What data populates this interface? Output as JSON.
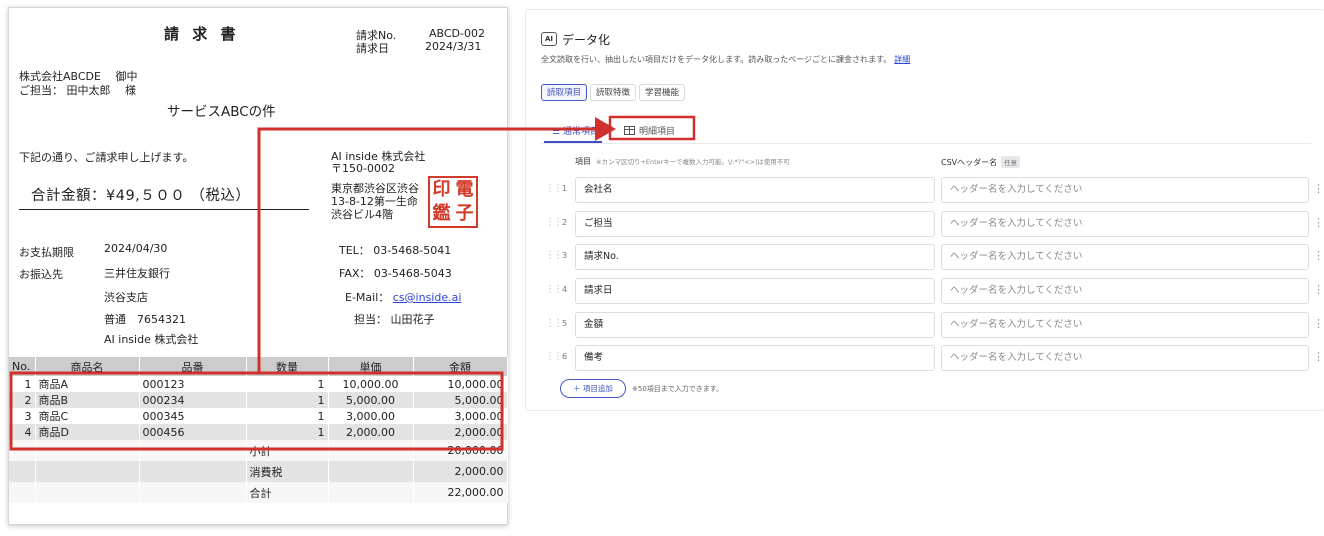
{
  "invoice": {
    "title": "請 求 書",
    "no_label": "請求No.",
    "no_value": "ABCD-002",
    "date_label": "請求日",
    "date_value": "2024/3/31",
    "client_company": "株式会社ABCDE　 御中",
    "client_person": "ご担当：  田中太郎　  様",
    "subject": "サービスABCの件",
    "greeting": "下記の通り、ご請求申し上げます。",
    "total_label": "合計金額：¥49,５００ （税込）",
    "issuer_name": "AI inside 株式会社",
    "issuer_zip": "〒150-0002",
    "issuer_addr1": "東京都渋谷区渋谷",
    "issuer_addr2": "13-8-12第一生命",
    "issuer_addr3": "渋谷ビル4階",
    "seal_chars": [
      "印",
      "電",
      "鑑",
      "子"
    ],
    "due_label": "お支払期限",
    "due_value": "2024/04/30",
    "bank_label": "お振込先",
    "bank_name": "三井住友銀行",
    "bank_branch": "渋谷支店",
    "bank_account": "普通　7654321",
    "bank_holder": "AI inside 株式会社",
    "tel": "TEL：  03-5468-5041",
    "fax": "FAX：  03-5468-5043",
    "email_label": "E-Mail：",
    "email_value": "cs@inside.ai",
    "staff": "担当：  山田花子",
    "table_headers": [
      "No.",
      "商品名",
      "品番",
      "数量",
      "単価",
      "金額"
    ],
    "rows": [
      {
        "no": "1",
        "name": "商品A",
        "code": "000123",
        "qty": "1",
        "unit": "10,000.00",
        "amount": "10,000.00"
      },
      {
        "no": "2",
        "name": "商品B",
        "code": "000234",
        "qty": "1",
        "unit": "5,000.00",
        "amount": "5,000.00"
      },
      {
        "no": "3",
        "name": "商品C",
        "code": "000345",
        "qty": "1",
        "unit": "3,000.00",
        "amount": "3,000.00"
      },
      {
        "no": "4",
        "name": "商品D",
        "code": "000456",
        "qty": "1",
        "unit": "2,000.00",
        "amount": "2,000.00"
      }
    ],
    "subtotal_label": "小計",
    "subtotal_value": "20,000.00",
    "tax_label": "消費税",
    "tax_value": "2,000.00",
    "grand_label": "合計",
    "grand_value": "22,000.00"
  },
  "annotation": {
    "color": "#d0312d"
  },
  "panel": {
    "ai_badge": "AI",
    "title": "データ化",
    "description": "全文読取を行い、抽出したい項目だけをデータ化します。読み取ったページごとに課金されます。",
    "detail_link": "詳細",
    "chips": [
      "読取項目",
      "読取特徴",
      "学習機能"
    ],
    "tab_basic": "通常項目",
    "tab_detail": "明細項目",
    "tab_detail_icon": "table-icon",
    "col_item_label": "項目",
    "col_item_hint": "※カンマ区切り+Enterキーで複数入力可能。\\/:*?\"<>|は使用不可",
    "col_csv_label": "CSVヘッダー名",
    "col_csv_badge": "任意",
    "csv_placeholder": "ヘッダー名を入力してください",
    "items": [
      {
        "num": "1",
        "name": "会社名"
      },
      {
        "num": "2",
        "name": "ご担当"
      },
      {
        "num": "3",
        "name": "請求No."
      },
      {
        "num": "4",
        "name": "請求日"
      },
      {
        "num": "5",
        "name": "金額"
      },
      {
        "num": "6",
        "name": "備考"
      }
    ],
    "add_button": "＋ 項目追加",
    "add_note": "※50項目まで入力できます。",
    "accent": "#3e50c0"
  }
}
